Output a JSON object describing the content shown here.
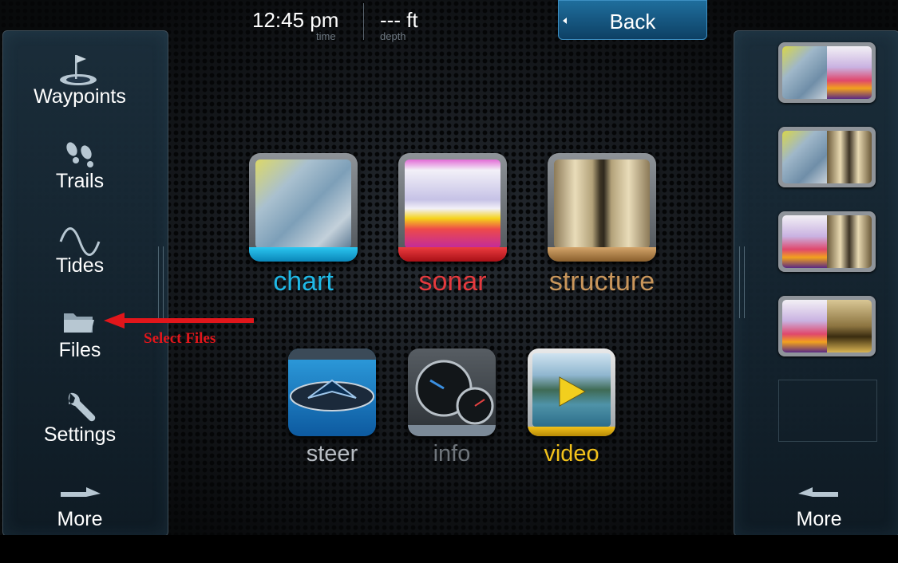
{
  "status": {
    "time_value": "12:45 pm",
    "time_caption": "time",
    "depth_value": "--- ft",
    "depth_caption": "depth"
  },
  "back_button": {
    "label": "Back"
  },
  "left_menu": {
    "items": [
      {
        "label": "Waypoints",
        "icon": "waypoint-flag-icon"
      },
      {
        "label": "Trails",
        "icon": "footprints-icon"
      },
      {
        "label": "Tides",
        "icon": "sine-wave-icon"
      },
      {
        "label": "Files",
        "icon": "folder-icon"
      },
      {
        "label": "Settings",
        "icon": "wrench-icon"
      },
      {
        "label": "More",
        "icon": "arrow-right-icon"
      }
    ]
  },
  "right_menu": {
    "more_label": "More",
    "more_icon": "arrow-left-icon",
    "split_views": [
      "chart-sonar",
      "chart-structure",
      "sonar-structure",
      "sonar-structure-sidescan"
    ]
  },
  "apps": {
    "row1": [
      {
        "label": "chart",
        "color": "#1fb8e6"
      },
      {
        "label": "sonar",
        "color": "#e43a3e"
      },
      {
        "label": "structure",
        "color": "#c9965b"
      }
    ],
    "row2": [
      {
        "label": "steer",
        "color": "#b7bcc2"
      },
      {
        "label": "info",
        "color": "#6f757b"
      },
      {
        "label": "video",
        "color": "#f3c21b"
      }
    ]
  },
  "annotation": {
    "text": "Select Files",
    "color": "#e1161b"
  }
}
